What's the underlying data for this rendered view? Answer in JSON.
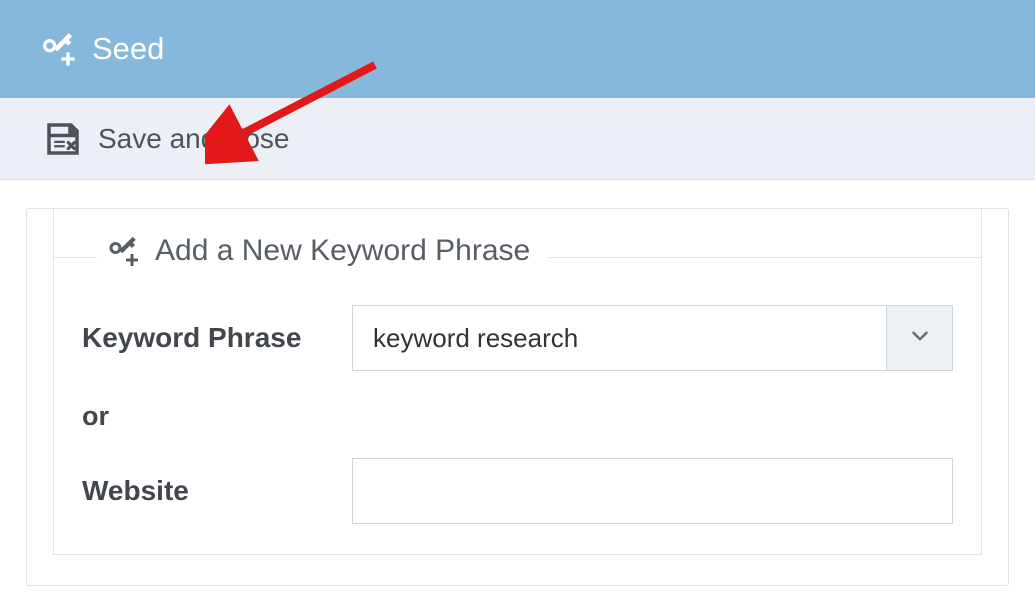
{
  "header": {
    "title": "Seed"
  },
  "toolbar": {
    "save_close_label": "Save and close"
  },
  "form": {
    "legend": "Add a New Keyword Phrase",
    "keyword_label": "Keyword Phrase",
    "keyword_value": "keyword research",
    "or_label": "or",
    "website_label": "Website",
    "website_value": ""
  },
  "colors": {
    "header_bg": "#86b8db",
    "toolbar_bg": "#ecf0f6",
    "text_dark": "#4c535a",
    "arrow": "#e31818"
  }
}
